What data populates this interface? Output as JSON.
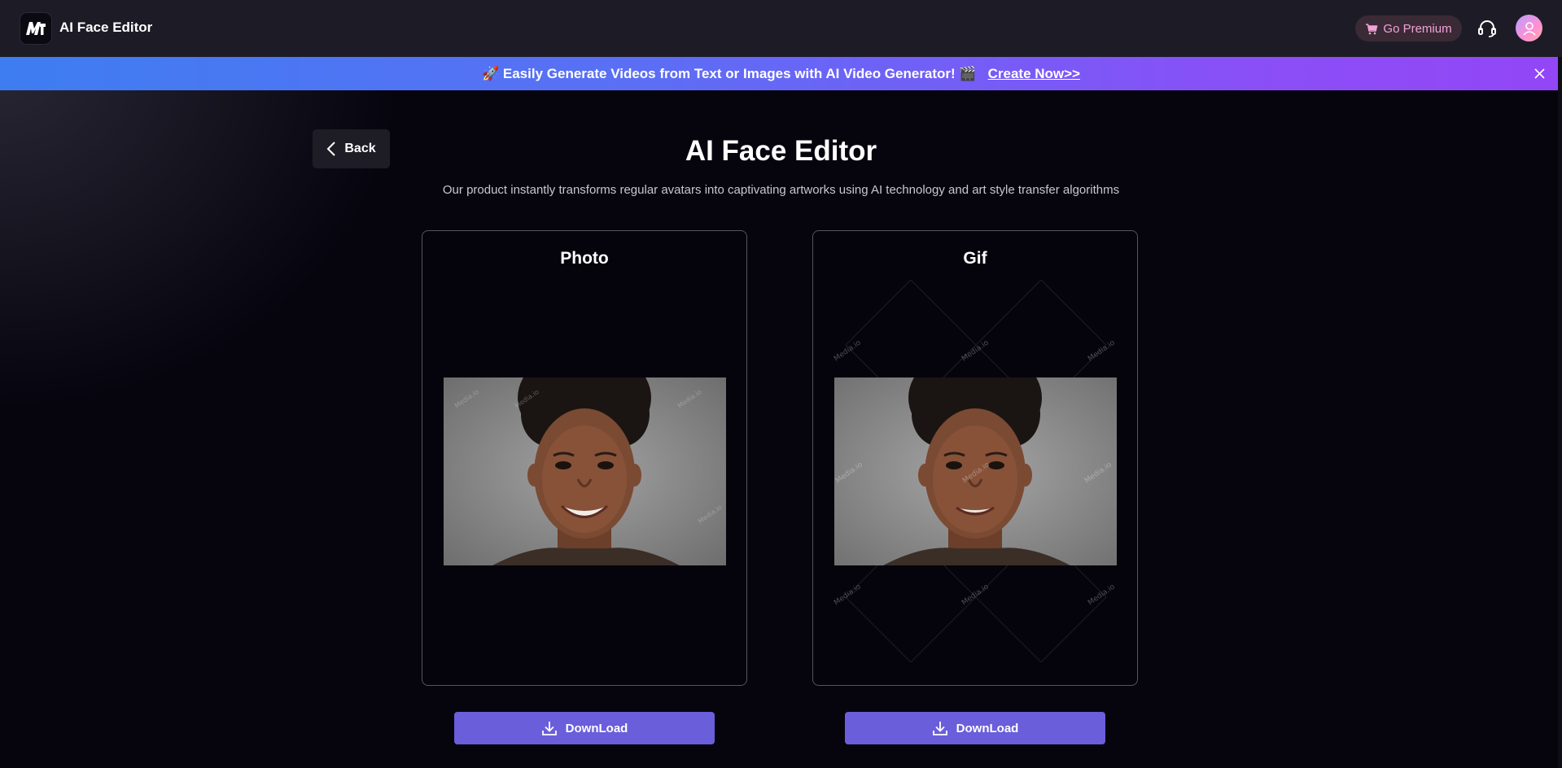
{
  "header": {
    "app_title": "AI Face Editor",
    "premium_label": "Go Premium",
    "icons": [
      "cart-icon",
      "headset-icon",
      "user-avatar-icon"
    ]
  },
  "banner": {
    "message": "🚀 Easily Generate Videos from Text or Images with AI Video Generator! 🎬",
    "cta": "Create Now>>"
  },
  "back_label": "Back",
  "page": {
    "title": "AI Face Editor",
    "subtitle": "Our product instantly transforms regular avatars into captivating artworks using AI technology and art style transfer algorithms"
  },
  "cards": [
    {
      "title": "Photo",
      "download_label": "DownLoad"
    },
    {
      "title": "Gif",
      "download_label": "DownLoad"
    }
  ],
  "watermark": "Media.io",
  "colors": {
    "accent_button": "#6a5edb",
    "premium_text": "#f1a3d8",
    "banner_start": "#3e7df1",
    "banner_end": "#9346f6"
  }
}
